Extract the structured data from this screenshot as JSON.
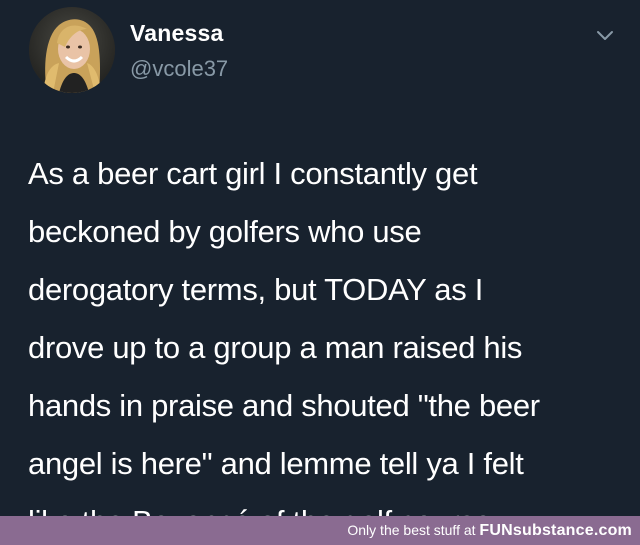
{
  "tweet": {
    "author": {
      "display_name": "Vanessa",
      "handle": "@vcole37",
      "avatar_icon": "profile-photo"
    },
    "menu_icon": "chevron-down-icon",
    "text_lines": [
      "As a beer cart girl I constantly get",
      "beckoned by golfers who use",
      "derogatory terms, but TODAY as I",
      "drove up to a group a man raised his",
      "hands in praise and shouted \"the beer",
      "angel is here\" and lemme tell ya I felt",
      "like the Beyoncé of the golf course"
    ]
  },
  "footer": {
    "tagline": "Only the best stuff at",
    "brand": "FUNsubstance.com"
  },
  "colors": {
    "background": "#18222e",
    "text": "#ffffff",
    "handle": "#8899a6",
    "footer_bar": "#8a6b91"
  }
}
